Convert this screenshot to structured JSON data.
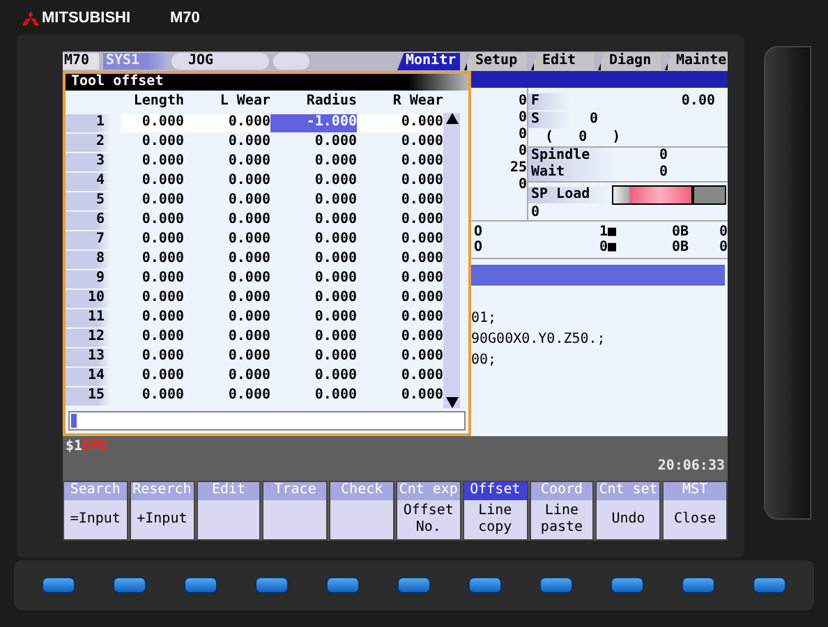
{
  "brand": {
    "maker": "MITSUBISHI",
    "model": "M70"
  },
  "header": {
    "model": "M70",
    "system": "SYS1",
    "mode": "JOG"
  },
  "tabs": [
    {
      "label": "Monitr",
      "selected": true
    },
    {
      "label": "Setup",
      "selected": false
    },
    {
      "label": "Edit",
      "selected": false
    },
    {
      "label": "Diagn",
      "selected": false
    },
    {
      "label": "Mainte",
      "selected": false
    }
  ],
  "tool_offset": {
    "title": "Tool offset",
    "columns": [
      "Length",
      "L Wear",
      "Radius",
      "R Wear"
    ],
    "rows": [
      {
        "number": "1",
        "selected": true,
        "cells": [
          {
            "value": "0.000",
            "selected": false
          },
          {
            "value": "0.000",
            "selected": false
          },
          {
            "value": "-1.000",
            "selected": true
          },
          {
            "value": "0.000",
            "selected": false
          }
        ]
      },
      {
        "number": "2",
        "selected": false,
        "cells": [
          {
            "value": "0.000",
            "selected": false
          },
          {
            "value": "0.000",
            "selected": false
          },
          {
            "value": "0.000",
            "selected": false
          },
          {
            "value": "0.000",
            "selected": false
          }
        ]
      },
      {
        "number": "3",
        "selected": false,
        "cells": [
          {
            "value": "0.000",
            "selected": false
          },
          {
            "value": "0.000",
            "selected": false
          },
          {
            "value": "0.000",
            "selected": false
          },
          {
            "value": "0.000",
            "selected": false
          }
        ]
      },
      {
        "number": "4",
        "selected": false,
        "cells": [
          {
            "value": "0.000",
            "selected": false
          },
          {
            "value": "0.000",
            "selected": false
          },
          {
            "value": "0.000",
            "selected": false
          },
          {
            "value": "0.000",
            "selected": false
          }
        ]
      },
      {
        "number": "5",
        "selected": false,
        "cells": [
          {
            "value": "0.000",
            "selected": false
          },
          {
            "value": "0.000",
            "selected": false
          },
          {
            "value": "0.000",
            "selected": false
          },
          {
            "value": "0.000",
            "selected": false
          }
        ]
      },
      {
        "number": "6",
        "selected": false,
        "cells": [
          {
            "value": "0.000",
            "selected": false
          },
          {
            "value": "0.000",
            "selected": false
          },
          {
            "value": "0.000",
            "selected": false
          },
          {
            "value": "0.000",
            "selected": false
          }
        ]
      },
      {
        "number": "7",
        "selected": false,
        "cells": [
          {
            "value": "0.000",
            "selected": false
          },
          {
            "value": "0.000",
            "selected": false
          },
          {
            "value": "0.000",
            "selected": false
          },
          {
            "value": "0.000",
            "selected": false
          }
        ]
      },
      {
        "number": "8",
        "selected": false,
        "cells": [
          {
            "value": "0.000",
            "selected": false
          },
          {
            "value": "0.000",
            "selected": false
          },
          {
            "value": "0.000",
            "selected": false
          },
          {
            "value": "0.000",
            "selected": false
          }
        ]
      },
      {
        "number": "9",
        "selected": false,
        "cells": [
          {
            "value": "0.000",
            "selected": false
          },
          {
            "value": "0.000",
            "selected": false
          },
          {
            "value": "0.000",
            "selected": false
          },
          {
            "value": "0.000",
            "selected": false
          }
        ]
      },
      {
        "number": "10",
        "selected": false,
        "cells": [
          {
            "value": "0.000",
            "selected": false
          },
          {
            "value": "0.000",
            "selected": false
          },
          {
            "value": "0.000",
            "selected": false
          },
          {
            "value": "0.000",
            "selected": false
          }
        ]
      },
      {
        "number": "11",
        "selected": false,
        "cells": [
          {
            "value": "0.000",
            "selected": false
          },
          {
            "value": "0.000",
            "selected": false
          },
          {
            "value": "0.000",
            "selected": false
          },
          {
            "value": "0.000",
            "selected": false
          }
        ]
      },
      {
        "number": "12",
        "selected": false,
        "cells": [
          {
            "value": "0.000",
            "selected": false
          },
          {
            "value": "0.000",
            "selected": false
          },
          {
            "value": "0.000",
            "selected": false
          },
          {
            "value": "0.000",
            "selected": false
          }
        ]
      },
      {
        "number": "13",
        "selected": false,
        "cells": [
          {
            "value": "0.000",
            "selected": false
          },
          {
            "value": "0.000",
            "selected": false
          },
          {
            "value": "0.000",
            "selected": false
          },
          {
            "value": "0.000",
            "selected": false
          }
        ]
      },
      {
        "number": "14",
        "selected": false,
        "cells": [
          {
            "value": "0.000",
            "selected": false
          },
          {
            "value": "0.000",
            "selected": false
          },
          {
            "value": "0.000",
            "selected": false
          },
          {
            "value": "0.000",
            "selected": false
          }
        ]
      },
      {
        "number": "15",
        "selected": false,
        "cells": [
          {
            "value": "0.000",
            "selected": false
          },
          {
            "value": "0.000",
            "selected": false
          },
          {
            "value": "0.000",
            "selected": false
          },
          {
            "value": "0.000",
            "selected": false
          }
        ]
      }
    ]
  },
  "monitor": {
    "axis_values": [
      "0",
      "0",
      "0",
      "0",
      "25",
      "0"
    ],
    "feed": {
      "label": "F",
      "value": "0.00"
    },
    "speed": {
      "label": "S",
      "value": "0"
    },
    "speed_command": "(   0   )",
    "spindle": {
      "label": "Spindle",
      "value": "0"
    },
    "wait": {
      "label": "Wait",
      "value": "0"
    },
    "load": {
      "label": "SP Load",
      "level": 0.72,
      "value": "0"
    },
    "modal_rows": [
      [
        "O",
        "1■",
        "0B",
        "0"
      ],
      [
        "O",
        "0■",
        "0B",
        "0"
      ]
    ],
    "program_lines": [
      "01;",
      "90G00X0.Y0.Z50.;",
      "00;"
    ]
  },
  "status": {
    "system": "$1",
    "alarm": "EMG",
    "time": "20:06:33"
  },
  "softkeys": [
    {
      "top": "Search",
      "bottom": "=Input",
      "selected": false
    },
    {
      "top": "Reserch",
      "bottom": "+Input",
      "selected": false
    },
    {
      "top": "Edit",
      "selected": false
    },
    {
      "top": "Trace",
      "selected": false
    },
    {
      "top": "Check",
      "selected": false
    },
    {
      "top": "Cnt exp",
      "bottom": "Offset No.",
      "selected": false
    },
    {
      "top": "Offset",
      "bottom": "Line copy",
      "selected": true
    },
    {
      "top": "Coord",
      "bottom": "Line paste",
      "selected": false
    },
    {
      "top": "Cnt set",
      "bottom": "Undo",
      "selected": false
    },
    {
      "top": "MST",
      "bottom": "Close",
      "selected": false
    }
  ]
}
